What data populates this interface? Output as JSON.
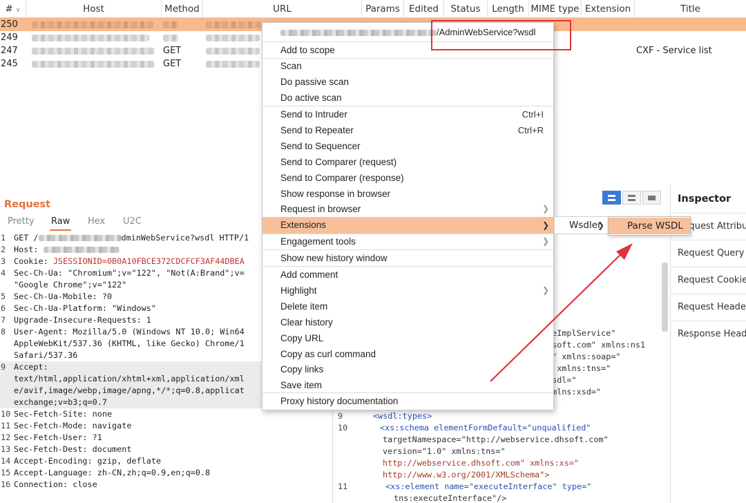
{
  "history": {
    "columns": [
      {
        "key": "num",
        "label": "#"
      },
      {
        "key": "host",
        "label": "Host"
      },
      {
        "key": "method",
        "label": "Method"
      },
      {
        "key": "url",
        "label": "URL"
      },
      {
        "key": "params",
        "label": "Params"
      },
      {
        "key": "edited",
        "label": "Edited"
      },
      {
        "key": "status",
        "label": "Status"
      },
      {
        "key": "length",
        "label": "Length"
      },
      {
        "key": "mime",
        "label": "MIME type"
      },
      {
        "key": "extension",
        "label": "Extension"
      },
      {
        "key": "title",
        "label": "Title"
      }
    ],
    "rows": [
      {
        "num": "250",
        "method": "",
        "title": "",
        "selected": true
      },
      {
        "num": "249",
        "method": "",
        "title": "",
        "selected": false
      },
      {
        "num": "247",
        "method": "GET",
        "title": "CXF - Service list",
        "selected": false
      },
      {
        "num": "245",
        "method": "GET",
        "title": "",
        "selected": false
      }
    ]
  },
  "request": {
    "title": "Request",
    "tabs": [
      "Pretty",
      "Raw",
      "Hex",
      "U2C"
    ],
    "active_tab": "Raw",
    "lines": [
      {
        "n": "1",
        "text": "GET /",
        "text2": "dminWebService?wsdl HTTP/1"
      },
      {
        "n": "2",
        "text": "Host: ",
        "text2": ""
      },
      {
        "n": "3",
        "text": "Cookie: ",
        "text2": "JSESSIONID=0B0A10FBCE372CDCFCF3AF44DBEA"
      },
      {
        "n": "4",
        "text": "Sec-Ch-Ua: \"Chromium\";v=\"122\", \"Not(A:Brand\";v="
      },
      {
        "n": "",
        "text": "\"Google Chrome\";v=\"122\""
      },
      {
        "n": "5",
        "text": "Sec-Ch-Ua-Mobile: ?0"
      },
      {
        "n": "6",
        "text": "Sec-Ch-Ua-Platform: \"Windows\""
      },
      {
        "n": "7",
        "text": "Upgrade-Insecure-Requests: 1"
      },
      {
        "n": "8",
        "text": "User-Agent: Mozilla/5.0 (Windows NT 10.0; Win64"
      },
      {
        "n": "",
        "text": "AppleWebKit/537.36 (KHTML, like Gecko) Chrome/1"
      },
      {
        "n": "",
        "text": "Safari/537.36"
      },
      {
        "n": "9",
        "text": "Accept:"
      },
      {
        "n": "",
        "text": "text/html,application/xhtml+xml,application/xml"
      },
      {
        "n": "",
        "text": "e/avif,image/webp,image/apng,*/*;q=0.8,applicat"
      },
      {
        "n": "",
        "text": "exchange;v=b3;q=0.7"
      },
      {
        "n": "10",
        "text": "Sec-Fetch-Site: none"
      },
      {
        "n": "11",
        "text": "Sec-Fetch-Mode: navigate"
      },
      {
        "n": "12",
        "text": "Sec-Fetch-User: ?1"
      },
      {
        "n": "13",
        "text": "Sec-Fetch-Dest: document"
      },
      {
        "n": "14",
        "text": "Accept-Encoding: gzip, deflate"
      },
      {
        "n": "15",
        "text": "Accept-Language: zh-CN,zh;q=0.9,en;q=0.8"
      },
      {
        "n": "16",
        "text": "Connection: close"
      }
    ]
  },
  "response": {
    "fragments": [
      {
        "text": "ceImplService\""
      },
      {
        "text": "hsoft.com\" xmlns:ns1"
      },
      {
        "text": "p\" xmlns:soap=\""
      },
      {
        "text": "\" xmlns:tns=\""
      },
      {
        "text": "wsdl=\""
      },
      {
        "text": "xmlns:xsd=\""
      }
    ],
    "lines": [
      {
        "n": "9",
        "text": "<wsdl:types>"
      },
      {
        "n": "10",
        "text": "<xs:schema elementFormDefault=\"unqualified\""
      },
      {
        "n": "",
        "text": "targetNamespace=\"http://webservice.dhsoft.com\""
      },
      {
        "n": "",
        "text": "version=\"1.0\" xmlns:tns=\""
      },
      {
        "n": "",
        "text": "http://webservice.dhsoft.com\" xmlns:xs=\""
      },
      {
        "n": "",
        "text": "http://www.w3.org/2001/XMLSchema\">"
      },
      {
        "n": "11",
        "text": "<xs:element name=\"executeInterface\" type=\""
      },
      {
        "n": "",
        "text": "tns:executeInterface\"/>"
      }
    ]
  },
  "inspector": {
    "title": "Inspector",
    "items": [
      "Request Attributes",
      "Request Query Parameters",
      "Request Cookies",
      "Request Headers",
      "Response Headers"
    ]
  },
  "context_menu": {
    "url_suffix": "/AdminWebService?wsdl",
    "items": [
      {
        "label": "Add to scope"
      },
      {
        "label": "Scan"
      },
      {
        "label": "Do passive scan"
      },
      {
        "label": "Do active scan"
      },
      {
        "label": "Send to Intruder",
        "shortcut": "Ctrl+I"
      },
      {
        "label": "Send to Repeater",
        "shortcut": "Ctrl+R"
      },
      {
        "label": "Send to Sequencer"
      },
      {
        "label": "Send to Comparer (request)"
      },
      {
        "label": "Send to Comparer (response)"
      },
      {
        "label": "Show response in browser"
      },
      {
        "label": "Request in browser",
        "submenu": true
      },
      {
        "label": "Extensions",
        "submenu": true,
        "hover": true
      },
      {
        "label": "Engagement tools",
        "submenu": true
      },
      {
        "label": "Show new history window"
      },
      {
        "label": "Add comment"
      },
      {
        "label": "Highlight",
        "submenu": true
      },
      {
        "label": "Delete item"
      },
      {
        "label": "Clear history"
      },
      {
        "label": "Copy URL"
      },
      {
        "label": "Copy as curl command"
      },
      {
        "label": "Copy links"
      },
      {
        "label": "Save item"
      },
      {
        "label": "Proxy history documentation"
      }
    ],
    "submenu_extensions": {
      "label": "Wsdler"
    },
    "submenu_wsdler": {
      "label": "Parse WSDL"
    }
  },
  "colors": {
    "accent": "#e8703a",
    "selected_row": "#f8b98c",
    "menu_hover": "#f8c09a",
    "annotation": "#e0333c",
    "view_active": "#3a7bd5"
  }
}
